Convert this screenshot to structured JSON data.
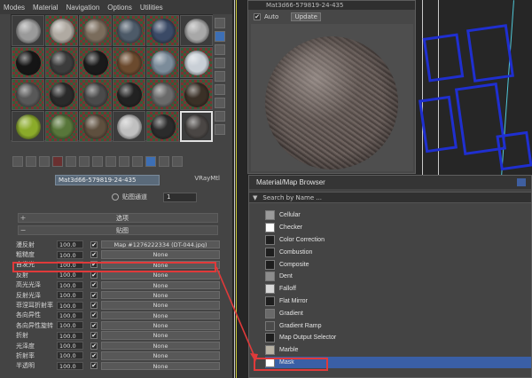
{
  "menu": [
    "Modes",
    "Material",
    "Navigation",
    "Options",
    "Utilities"
  ],
  "material_slots": [
    {
      "color": "#9a9a9a",
      "checker": false
    },
    {
      "color": "#b0aaa2",
      "checker": true
    },
    {
      "color": "#7a6c5c",
      "checker": true
    },
    {
      "color": "#4d5a68",
      "checker": true
    },
    {
      "color": "#3b4a66",
      "checker": true
    },
    {
      "color": "#a8a8a8",
      "checker": false
    },
    {
      "color": "#151515",
      "checker": true
    },
    {
      "color": "#3c3c3c",
      "checker": true
    },
    {
      "color": "#1a1a1a",
      "checker": true
    },
    {
      "color": "#6b4a2e",
      "checker": true
    },
    {
      "color": "#7c8c9a",
      "checker": true
    },
    {
      "color": "#c9cfd6",
      "checker": true
    },
    {
      "color": "#585858",
      "checker": true
    },
    {
      "color": "#2a2a2a",
      "checker": true
    },
    {
      "color": "#4a4a4a",
      "checker": true
    },
    {
      "color": "#222222",
      "checker": true
    },
    {
      "color": "#6a6a6a",
      "checker": true
    },
    {
      "color": "#3a3026",
      "checker": true
    },
    {
      "color": "#8bab2a",
      "checker": false
    },
    {
      "color": "#58763a",
      "checker": true
    },
    {
      "color": "#5e4f3e",
      "checker": true
    },
    {
      "color": "#c0c0c0",
      "checker": false
    },
    {
      "color": "#2b2b2b",
      "checker": true
    },
    {
      "color": "#4a4644",
      "checker": false,
      "selected": true
    }
  ],
  "material_name": "Mat3d66-579819-24-435",
  "material_type": "VRayMtl",
  "channel_label": "贴图通道",
  "channel_value": "1",
  "rollouts": {
    "options": "选项",
    "maps": "贴图"
  },
  "maps": [
    {
      "label": "漫反射",
      "amount": "100.0",
      "checked": true,
      "map": "Map #1276222334 (DT-044.jpg)"
    },
    {
      "label": "粗糙度",
      "amount": "100.0",
      "checked": true,
      "map": "None"
    },
    {
      "label": "自发光",
      "amount": "100.0",
      "checked": true,
      "map": "None"
    },
    {
      "label": "反射",
      "amount": "100.0",
      "checked": true,
      "map": "None"
    },
    {
      "label": "高光光泽",
      "amount": "100.0",
      "checked": true,
      "map": "None"
    },
    {
      "label": "反射光泽",
      "amount": "100.0",
      "checked": true,
      "map": "None"
    },
    {
      "label": "菲涅耳折射率",
      "amount": "100.0",
      "checked": true,
      "map": "None"
    },
    {
      "label": "各向异性",
      "amount": "100.0",
      "checked": true,
      "map": "None"
    },
    {
      "label": "各向异性旋转",
      "amount": "100.0",
      "checked": true,
      "map": "None"
    },
    {
      "label": "折射",
      "amount": "100.0",
      "checked": true,
      "map": "None"
    },
    {
      "label": "光泽度",
      "amount": "100.0",
      "checked": true,
      "map": "None"
    },
    {
      "label": "折射率",
      "amount": "100.0",
      "checked": true,
      "map": "None"
    },
    {
      "label": "半透明",
      "amount": "100.0",
      "checked": true,
      "map": "None"
    }
  ],
  "preview": {
    "title": "Mat3d66-579819-24-435",
    "auto_label": "Auto",
    "update_label": "Update"
  },
  "browser": {
    "title": "Material/Map Browser",
    "search_placeholder": "Search by Name ...",
    "items": [
      {
        "label": "Cellular",
        "swatch": "#9a9a9a"
      },
      {
        "label": "Checker",
        "swatch": "#ffffff"
      },
      {
        "label": "Color Correction",
        "swatch": "#1e1e1e"
      },
      {
        "label": "Combustion",
        "swatch": "#1e1e1e"
      },
      {
        "label": "Composite",
        "swatch": "#1e1e1e"
      },
      {
        "label": "Dent",
        "swatch": "#8c8c8c"
      },
      {
        "label": "Falloff",
        "swatch": "#d8d8d8"
      },
      {
        "label": "Flat Mirror",
        "swatch": "#1e1e1e"
      },
      {
        "label": "Gradient",
        "swatch": "#6a6a6a"
      },
      {
        "label": "Gradient Ramp",
        "swatch": "#4a4a4a"
      },
      {
        "label": "Map Output Selector",
        "swatch": "#1e1e1e"
      },
      {
        "label": "Marble",
        "swatch": "#b8b2a4"
      },
      {
        "label": "Mask",
        "swatch": "#ffffff",
        "selected": true
      }
    ]
  },
  "colors": {
    "highlight": "#e03a3a",
    "selection": "#3a5fa6",
    "viewport_blue": "#1f2fd0"
  }
}
